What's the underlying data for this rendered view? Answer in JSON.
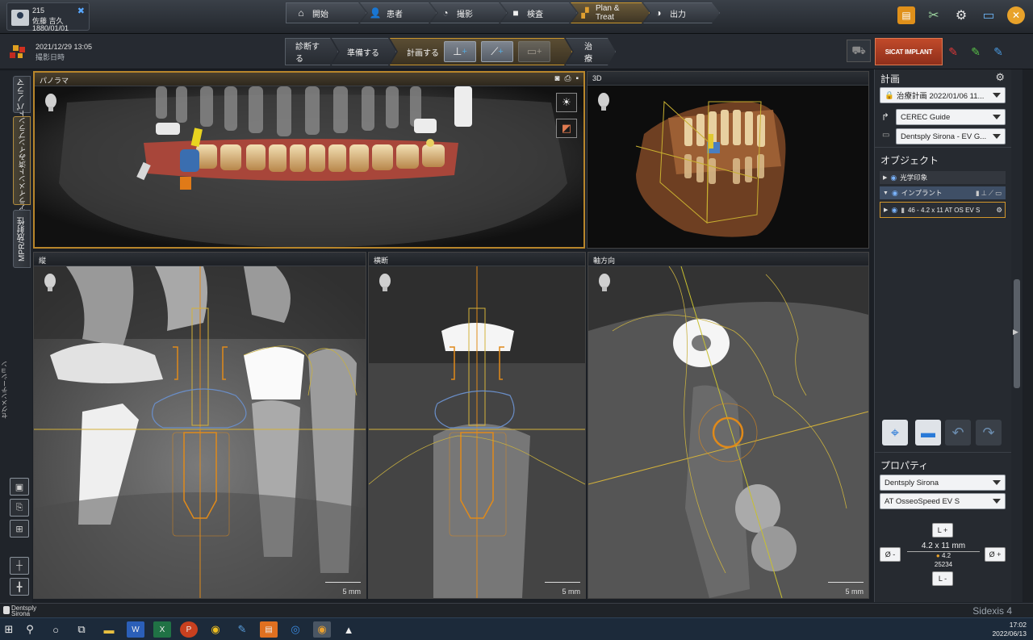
{
  "patient": {
    "id": "215",
    "name": "佐藤 吉久",
    "dob": "1880/01/01"
  },
  "workflow": [
    {
      "label": "開始",
      "icon": "home-icon"
    },
    {
      "label": "患者",
      "icon": "person-icon"
    },
    {
      "label": "撮影",
      "icon": "camera-icon"
    },
    {
      "label": "検査",
      "icon": "monitor-icon"
    },
    {
      "label": "Plan & Treat",
      "icon": "blocks-icon"
    },
    {
      "label": "出力",
      "icon": "globe-icon"
    }
  ],
  "capture": {
    "datetime": "2021/12/29 13:05",
    "label": "撮影日時"
  },
  "phases": {
    "diagnose": "診断する",
    "prepare": "準備する",
    "plan": "計画する",
    "treat": "治療"
  },
  "sicat_label": "SICAT IMPLANT",
  "side_tabs": {
    "panorama": "パノラマ",
    "alignment": "アライメント済みインプラント",
    "mpr": "MPR/放射性"
  },
  "side_segment": "セグメンテーション",
  "viewports": {
    "panorama": "パノラマ",
    "three_d": "3D",
    "longitudinal": "縦",
    "cross": "横断",
    "axial": "軸方向"
  },
  "scale_label": "5 mm",
  "plan": {
    "title": "計画",
    "plan_name": "治療計画 2022/01/06 11...",
    "guide": "CEREC Guide",
    "sleeve": "Dentsply Sirona - EV G..."
  },
  "objects": {
    "title": "オブジェクト",
    "items": [
      {
        "label": "光学印象"
      },
      {
        "label": "インプラント"
      },
      {
        "label": "46 - 4.2 x 11 AT OS EV S"
      }
    ]
  },
  "properties": {
    "title": "プロパティ",
    "manufacturer": "Dentsply Sirona",
    "product": "AT OsseoSpeed EV S",
    "size": "4.2 x 11 mm",
    "diameter": "4.2",
    "article": "25234",
    "btn_len_plus": "L +",
    "btn_len_minus": "L -",
    "btn_dia_minus": "Ø -",
    "btn_dia_plus": "Ø +"
  },
  "footer": {
    "brand_line1": "Dentsply",
    "brand_line2": "Sirona",
    "product": "Sidexis 4"
  },
  "clock": {
    "time": "17:02",
    "date": "2022/06/13"
  },
  "colors": {
    "accent": "#c9962e",
    "implant_orange": "#e08a1a",
    "guide_line": "#d4b23a"
  }
}
